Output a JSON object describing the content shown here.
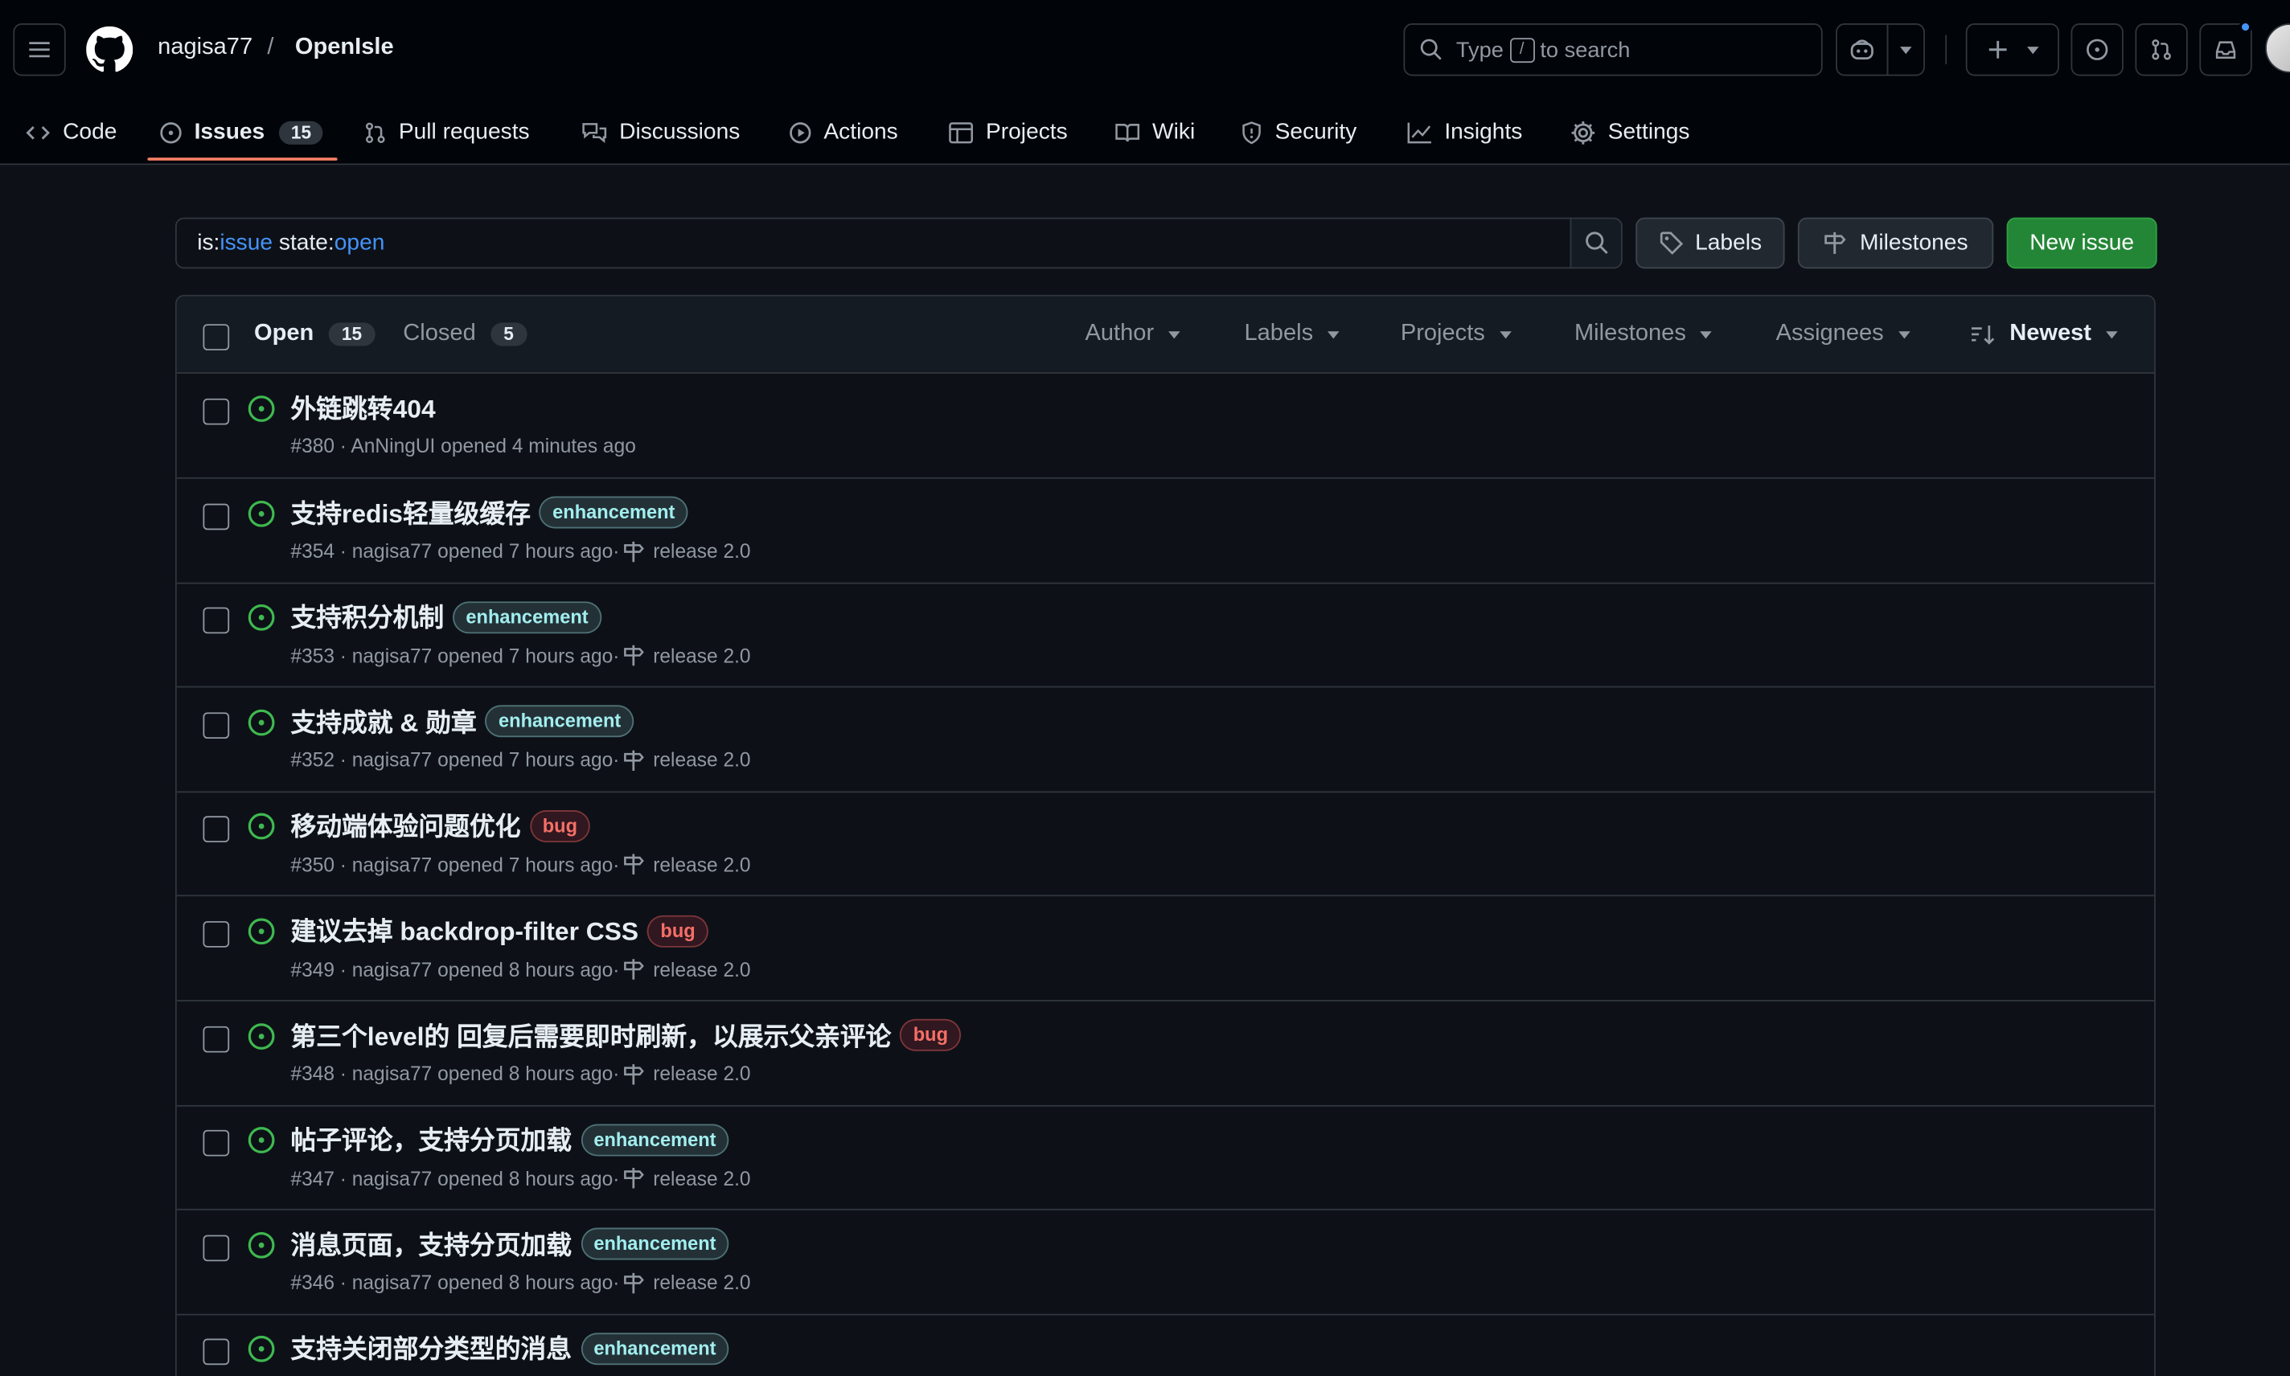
{
  "header": {
    "owner": "nagisa77",
    "separator": "/",
    "repo": "OpenIsle",
    "search": {
      "prefix": "Type",
      "key": "/",
      "suffix": "to search"
    }
  },
  "tabs": [
    {
      "label": "Code",
      "icon": "code-icon"
    },
    {
      "label": "Issues",
      "icon": "issue-opened-icon",
      "count": "15",
      "active": true
    },
    {
      "label": "Pull requests",
      "icon": "git-pull-request-icon"
    },
    {
      "label": "Discussions",
      "icon": "comment-discussion-icon"
    },
    {
      "label": "Actions",
      "icon": "play-icon"
    },
    {
      "label": "Projects",
      "icon": "table-icon"
    },
    {
      "label": "Wiki",
      "icon": "book-icon"
    },
    {
      "label": "Security",
      "icon": "shield-icon"
    },
    {
      "label": "Insights",
      "icon": "graph-icon"
    },
    {
      "label": "Settings",
      "icon": "gear-icon"
    }
  ],
  "filter": {
    "query_key1": "is:",
    "query_val1": "issue",
    "query_key2": " state:",
    "query_val2": "open"
  },
  "buttons": {
    "labels": "Labels",
    "milestones": "Milestones",
    "new_issue": "New issue"
  },
  "list_header": {
    "open_label": "Open",
    "open_count": "15",
    "closed_label": "Closed",
    "closed_count": "5",
    "filters": [
      "Author",
      "Labels",
      "Projects",
      "Milestones",
      "Assignees"
    ],
    "sort": "Newest"
  },
  "issues": [
    {
      "title": "外链跳转404",
      "labels": [],
      "meta": "#380 · AnNingUI opened 4 minutes ago",
      "milestone": ""
    },
    {
      "title": "支持redis轻量级缓存",
      "labels": [
        "enhancement"
      ],
      "meta": "#354 · nagisa77 opened 7 hours ago·",
      "milestone": "release 2.0"
    },
    {
      "title": "支持积分机制",
      "labels": [
        "enhancement"
      ],
      "meta": "#353 · nagisa77 opened 7 hours ago·",
      "milestone": "release 2.0"
    },
    {
      "title": "支持成就 & 勋章",
      "labels": [
        "enhancement"
      ],
      "meta": "#352 · nagisa77 opened 7 hours ago·",
      "milestone": "release 2.0"
    },
    {
      "title": "移动端体验问题优化",
      "labels": [
        "bug"
      ],
      "meta": "#350 · nagisa77 opened 7 hours ago·",
      "milestone": "release 2.0"
    },
    {
      "title": "建议去掉 backdrop-filter CSS",
      "labels": [
        "bug"
      ],
      "meta": "#349 · nagisa77 opened 8 hours ago·",
      "milestone": "release 2.0"
    },
    {
      "title": "第三个level的 回复后需要即时刷新，以展示父亲评论",
      "labels": [
        "bug"
      ],
      "meta": "#348 · nagisa77 opened 8 hours ago·",
      "milestone": "release 2.0"
    },
    {
      "title": "帖子评论，支持分页加载",
      "labels": [
        "enhancement"
      ],
      "meta": "#347 · nagisa77 opened 8 hours ago·",
      "milestone": "release 2.0"
    },
    {
      "title": "消息页面，支持分页加载",
      "labels": [
        "enhancement"
      ],
      "meta": "#346 · nagisa77 opened 8 hours ago·",
      "milestone": "release 2.0"
    },
    {
      "title": "支持关闭部分类型的消息",
      "labels": [
        "enhancement"
      ],
      "meta": "",
      "milestone": ""
    }
  ],
  "colors": {
    "accent_tab": "#f78166",
    "open_issue": "#3fb950",
    "primary_button": "#238636",
    "link": "#4493f8"
  }
}
